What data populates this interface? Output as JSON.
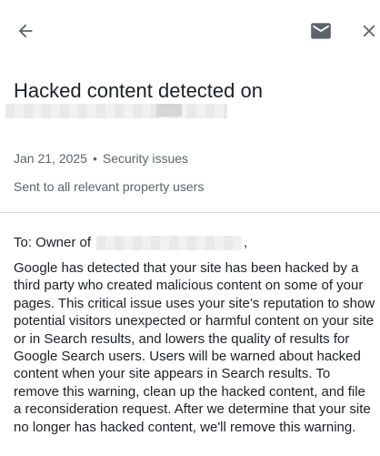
{
  "topbar": {
    "back_icon": "arrow-left-icon",
    "mail_icon": "envelope-icon",
    "close_icon": "close-icon"
  },
  "message": {
    "title": "Hacked content detected on",
    "date": "Jan 21, 2025",
    "separator": "•",
    "category": "Security issues",
    "recipients_note": "Sent to all relevant property users",
    "greeting_prefix": "To: Owner of",
    "greeting_suffix": ",",
    "body": "Google has detected that your site has been hacked by a third party who created malicious content on some of your pages. This critical issue uses your site’s reputation to show potential visitors unexpected or harmful content on your site or in Search results, and lowers the quality of results for Google Search users. Users will be warned about hacked content when your site appears in Search results. To remove this warning, clean up the hacked content, and file a reconsideration request. After we determine that your site no longer has hacked content, we'll remove this warning."
  },
  "colors": {
    "text_primary": "#202124",
    "text_secondary": "#5f6368",
    "icon": "#5f6368",
    "divider": "#dadce0"
  }
}
